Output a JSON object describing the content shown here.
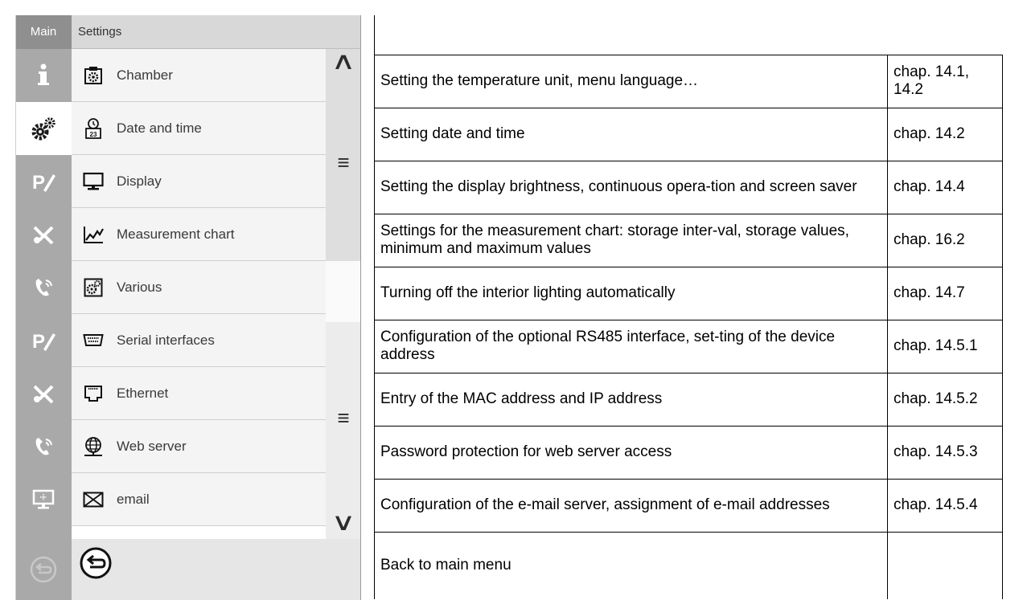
{
  "screen": {
    "main_tab_label": "Main",
    "header_title": "Settings",
    "side_tabs": [
      {
        "icon": "info-icon",
        "active": false
      },
      {
        "icon": "gears-icon",
        "active": true
      },
      {
        "icon": "program-edit-icon",
        "active": false
      },
      {
        "icon": "service-tools-icon",
        "active": false
      },
      {
        "icon": "phone-icon",
        "active": false
      },
      {
        "icon": "program-edit-icon",
        "active": false
      },
      {
        "icon": "service-tools-icon",
        "active": false
      },
      {
        "icon": "phone-icon",
        "active": false
      },
      {
        "icon": "monitor-icon",
        "active": false
      },
      {
        "icon": "back-icon",
        "active": false
      }
    ],
    "menu_items": [
      {
        "label": "Chamber",
        "icon": "chamber-icon"
      },
      {
        "label": "Date and time",
        "icon": "calendar-clock-icon"
      },
      {
        "label": "Display",
        "icon": "display-icon"
      },
      {
        "label": "Measurement chart",
        "icon": "chart-icon"
      },
      {
        "label": "Various",
        "icon": "various-gears-icon"
      },
      {
        "label": "Serial interfaces",
        "icon": "serial-port-icon"
      },
      {
        "label": "Ethernet",
        "icon": "ethernet-icon"
      },
      {
        "label": "Web server",
        "icon": "globe-icon"
      },
      {
        "label": "email",
        "icon": "envelope-icon"
      }
    ],
    "scroll_up_glyph": "∧",
    "scroll_handle_glyph": "≡",
    "scroll_down_glyph": "∨",
    "colors": {
      "sidebar": "#a9a9a9",
      "menu_bg": "#f4f4f4",
      "header_bg": "#d8d8d8"
    }
  },
  "table": {
    "header_row": [
      "",
      ""
    ],
    "rows": [
      {
        "description": "Setting the temperature unit, menu language…",
        "ref": "chap. 14.1, 14.2"
      },
      {
        "description": "Setting date and time",
        "ref": "chap. 14.2"
      },
      {
        "description": "Setting the display brightness, continuous opera-tion and screen saver",
        "ref": "chap. 14.4"
      },
      {
        "description": "Settings for the measurement chart: storage inter-val, storage values, minimum and maximum values",
        "ref": "chap. 16.2"
      },
      {
        "description": "Turning off the interior lighting automatically",
        "ref": "chap. 14.7"
      },
      {
        "description": "Configuration of the optional RS485 interface, set-ting of the device address",
        "ref": "chap. 14.5.1"
      },
      {
        "description": "Entry of the MAC address and IP address",
        "ref": "chap. 14.5.2"
      },
      {
        "description": "Password protection for web server access",
        "ref": "chap. 14.5.3"
      },
      {
        "description": "Configuration of the e-mail server, assignment of e-mail addresses",
        "ref": "chap. 14.5.4"
      },
      {
        "description": "Back to main menu",
        "ref": ""
      }
    ]
  }
}
